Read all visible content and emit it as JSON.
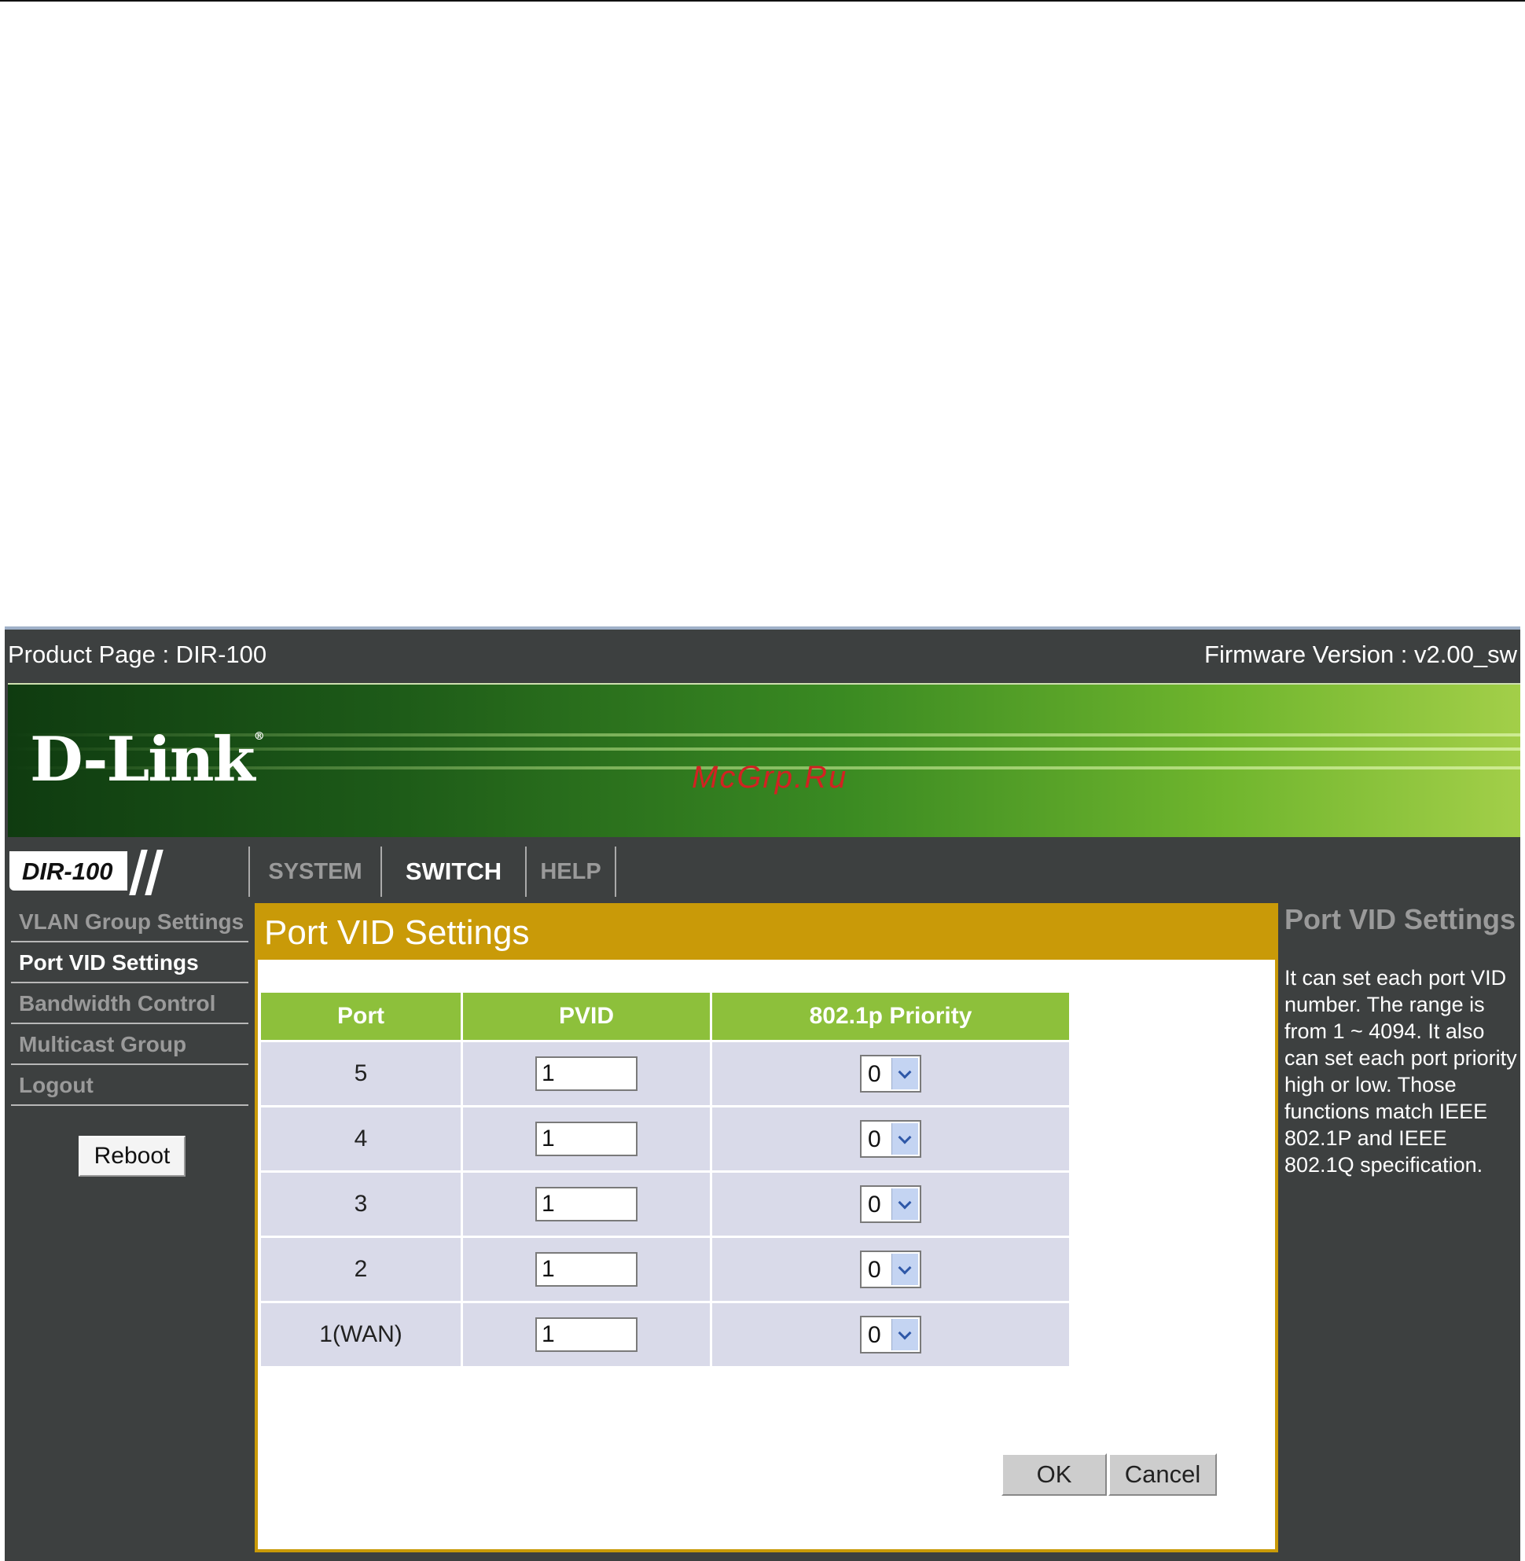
{
  "topbar": {
    "product": "Product Page : DIR-100",
    "firmware": "Firmware Version : v2.00_sw"
  },
  "banner": {
    "brand": "D-Link",
    "registered_mark": "®",
    "watermark": "McGrp.Ru"
  },
  "nav": {
    "model": "DIR-100",
    "tabs": [
      {
        "label": "SYSTEM",
        "active": false
      },
      {
        "label": "SWITCH",
        "active": true
      },
      {
        "label": "HELP",
        "active": false
      }
    ]
  },
  "sidebar": {
    "items": [
      {
        "label": "VLAN Group Settings",
        "active": false
      },
      {
        "label": "Port VID Settings",
        "active": true
      },
      {
        "label": "Bandwidth Control",
        "active": false
      },
      {
        "label": "Multicast Group",
        "active": false
      },
      {
        "label": "Logout",
        "active": false
      }
    ],
    "reboot_label": "Reboot"
  },
  "main": {
    "title": "Port VID Settings",
    "columns": [
      "Port",
      "PVID",
      "802.1p Priority"
    ],
    "rows": [
      {
        "port": "5",
        "pvid": "1",
        "priority": "0"
      },
      {
        "port": "4",
        "pvid": "1",
        "priority": "0"
      },
      {
        "port": "3",
        "pvid": "1",
        "priority": "0"
      },
      {
        "port": "2",
        "pvid": "1",
        "priority": "0"
      },
      {
        "port": "1(WAN)",
        "pvid": "1",
        "priority": "0"
      }
    ],
    "ok_label": "OK",
    "cancel_label": "Cancel"
  },
  "help": {
    "title": "Port VID Settings",
    "body": "It can set each port VID number. The range is from 1 ~ 4094. It also can set each port priority high or low. Those functions match IEEE 802.1P and IEEE 802.1Q specification."
  },
  "colors": {
    "chrome_dark": "#3d4040",
    "panel_gold": "#c99a08",
    "table_header_green": "#8dc03b",
    "table_cell": "#d9dae9",
    "watermark_red": "#d22222"
  }
}
